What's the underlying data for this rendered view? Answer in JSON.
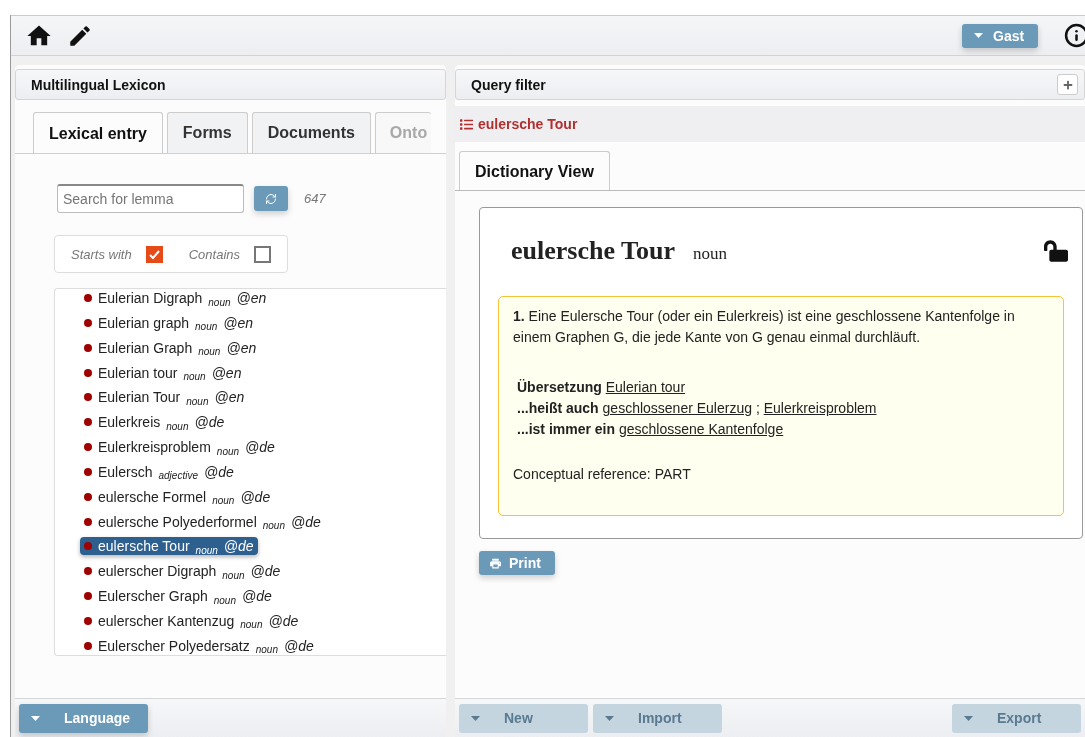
{
  "toolbar": {
    "user_button": "Gast"
  },
  "left_panel": {
    "title": "Multilingual Lexicon",
    "tabs": [
      {
        "label": "Lexical entry",
        "selected": true,
        "disabled": false
      },
      {
        "label": "Forms",
        "selected": false,
        "disabled": false
      },
      {
        "label": "Documents",
        "selected": false,
        "disabled": false
      },
      {
        "label": "Onto",
        "selected": false,
        "disabled": true
      }
    ],
    "search": {
      "placeholder": "Search for lemma",
      "count": "647"
    },
    "filters": [
      {
        "label": "Starts with",
        "checked": true
      },
      {
        "label": "Contains",
        "checked": false
      }
    ],
    "entries": [
      {
        "lemma": "Eulerian Digraph",
        "pos": "noun",
        "lang": "@en",
        "selected": false
      },
      {
        "lemma": "Eulerian graph",
        "pos": "noun",
        "lang": "@en",
        "selected": false
      },
      {
        "lemma": "Eulerian Graph",
        "pos": "noun",
        "lang": "@en",
        "selected": false
      },
      {
        "lemma": "Eulerian tour",
        "pos": "noun",
        "lang": "@en",
        "selected": false
      },
      {
        "lemma": "Eulerian Tour",
        "pos": "noun",
        "lang": "@en",
        "selected": false
      },
      {
        "lemma": "Eulerkreis",
        "pos": "noun",
        "lang": "@de",
        "selected": false
      },
      {
        "lemma": "Eulerkreisproblem",
        "pos": "noun",
        "lang": "@de",
        "selected": false
      },
      {
        "lemma": "Eulersch",
        "pos": "adjective",
        "lang": "@de",
        "selected": false
      },
      {
        "lemma": "eulersche Formel",
        "pos": "noun",
        "lang": "@de",
        "selected": false
      },
      {
        "lemma": "eulersche Polyederformel",
        "pos": "noun",
        "lang": "@de",
        "selected": false
      },
      {
        "lemma": "eulersche Tour",
        "pos": "noun",
        "lang": "@de",
        "selected": true
      },
      {
        "lemma": "eulerscher Digraph",
        "pos": "noun",
        "lang": "@de",
        "selected": false
      },
      {
        "lemma": "Eulerscher Graph",
        "pos": "noun",
        "lang": "@de",
        "selected": false
      },
      {
        "lemma": "eulerscher Kantenzug",
        "pos": "noun",
        "lang": "@de",
        "selected": false
      },
      {
        "lemma": "Eulerscher Polyedersatz",
        "pos": "noun",
        "lang": "@de",
        "selected": false
      }
    ],
    "footer_button": {
      "label": "Language",
      "disabled": false
    }
  },
  "right_panel": {
    "title": "Query filter",
    "breadcrumb": "eulersche Tour",
    "tabs": [
      {
        "label": "Dictionary View",
        "selected": true
      }
    ],
    "entry": {
      "lemma": "eulersche Tour",
      "pos": "noun",
      "locked": false,
      "definition": "**1.** Eine Eulersche Tour (oder ein Eulerkreis) ist eine geschlossene Kantenfolge in einem Graphen G, die jede Kante von G genau einmal durchläuft.",
      "relations": [
        {
          "label": "Übersetzung",
          "links": [
            "Eulerian tour"
          ]
        },
        {
          "label": "...heißt auch",
          "links": [
            "geschlossener Eulerzug",
            "Eulerkreisproblem"
          ]
        },
        {
          "label": "...ist immer ein",
          "links": [
            "geschlossene Kantenfolge"
          ]
        }
      ],
      "reference": "Conceptual reference: PART",
      "separator": ";"
    },
    "print_button": "Print",
    "footer_buttons": [
      {
        "label": "New",
        "disabled": true
      },
      {
        "label": "Import",
        "disabled": true
      },
      {
        "label": "Export",
        "disabled": true
      }
    ]
  }
}
